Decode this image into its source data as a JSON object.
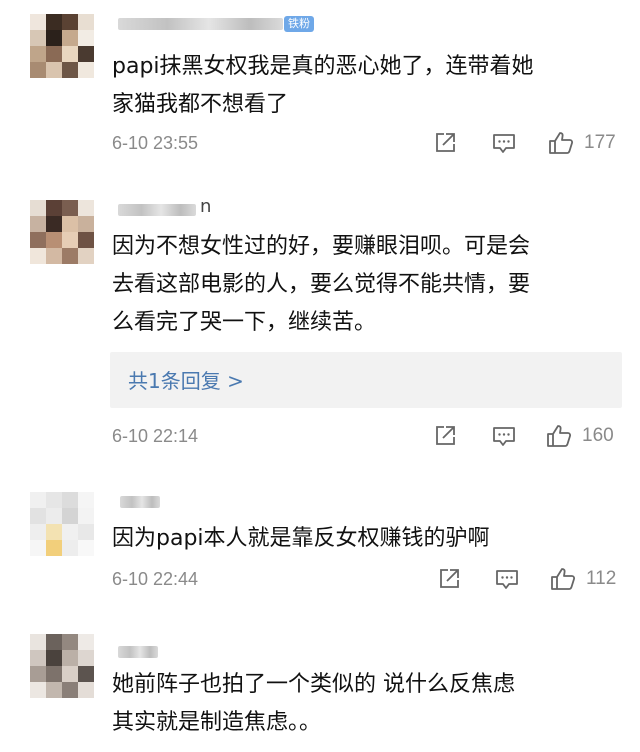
{
  "comments": [
    {
      "badge": "铁粉",
      "name_suffix": "",
      "text": "papi抹黑女权我是真的恶心她了，连带着她\n家猫我都不想看了",
      "time": "6-10 23:55",
      "likes": "177",
      "replies": ""
    },
    {
      "badge": "",
      "name_suffix": "n",
      "text": "因为不想女性过的好，要赚眼泪呗。可是会\n去看这部电影的人，要么觉得不能共情，要\n么看完了哭一下，继续苦。",
      "time": "6-10 22:14",
      "likes": "160",
      "replies": "共1条回复 >"
    },
    {
      "badge": "",
      "name_suffix": "",
      "text": "因为papi本人就是靠反女权赚钱的驴啊",
      "time": "6-10 22:44",
      "likes": "112",
      "replies": ""
    },
    {
      "badge": "",
      "name_suffix": "",
      "text": "她前阵子也拍了一个类似的 说什么反焦虑\n其实就是制造焦虑。。",
      "time": "",
      "likes": "",
      "replies": ""
    }
  ],
  "icons": {
    "share": "share-icon",
    "comment": "comment-icon",
    "like": "thumbs-up-icon"
  },
  "colors": {
    "link": "#4a79b0",
    "meta": "#8a8a8a",
    "badge": "#6fa8e8"
  }
}
